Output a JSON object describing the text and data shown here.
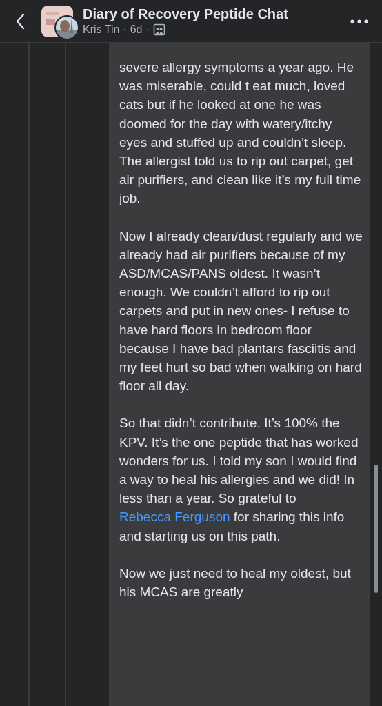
{
  "header": {
    "title": "Diary of Recovery Peptide Chat",
    "author": "Kris Tin",
    "separator_1": "·",
    "time": "6d",
    "separator_2": "·"
  },
  "comment": {
    "paragraphs": [
      {
        "parts": [
          {
            "kind": "text",
            "text": "severe allergy symptoms a year ago. He was miserable, could t eat much, loved cats but if he looked at one he was doomed for the day with watery/itchy eyes and stuffed up and couldn’t sleep. The allergist told us to rip out carpet, get air purifiers, and clean like it’s my full time job."
          }
        ]
      },
      {
        "parts": [
          {
            "kind": "text",
            "text": "Now I already clean/dust regularly and we already had air purifiers because of my ASD/MCAS/PANS oldest. It wasn’t enough. We couldn’t afford to rip out carpets and put in new ones- I refuse to have hard floors in bedroom floor because I have bad plantars fasciitis and my feet hurt so bad when walking on hard floor all day."
          }
        ]
      },
      {
        "parts": [
          {
            "kind": "text",
            "text": "So that didn’t contribute. It’s 100% the KPV. It’s the one peptide that has worked wonders for us. I told my son I would find a way to heal his allergies and we did! In less than a year. So grateful to"
          },
          {
            "kind": "link",
            "text": "Rebecca Ferguson"
          },
          {
            "kind": "text",
            "text": "for sharing this info and starting us on this path."
          }
        ]
      },
      {
        "parts": [
          {
            "kind": "text",
            "text": "Now we just need to heal my oldest, but his MCAS are greatly"
          }
        ]
      }
    ]
  }
}
